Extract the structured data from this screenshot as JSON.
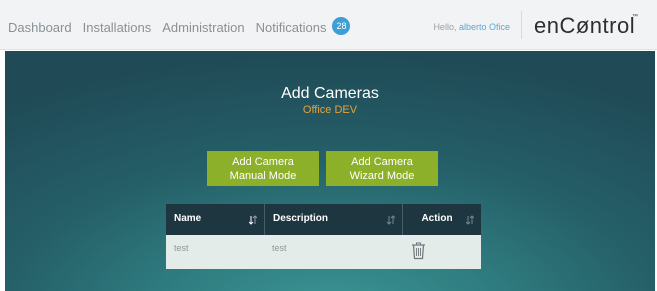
{
  "nav": {
    "items": [
      "Dashboard",
      "Installations",
      "Administration",
      "Notifications"
    ],
    "notification_count": "28"
  },
  "user": {
    "greeting": "Hello,",
    "name": "alberto Ofice"
  },
  "brand": {
    "logo": "enCøntrol",
    "tm": "™"
  },
  "page": {
    "title": "Add Cameras",
    "subtitle": "Office DEV"
  },
  "buttons": {
    "manual": {
      "line1": "Add Camera",
      "line2": "Manual Mode"
    },
    "wizard": {
      "line1": "Add Camera",
      "line2": "Wizard Mode"
    }
  },
  "table": {
    "columns": [
      "Name",
      "Description",
      "Action"
    ],
    "rows": [
      {
        "name": "test",
        "description": "test",
        "action_icon": "trash-icon"
      }
    ]
  },
  "colors": {
    "accent_button": "#8db02b",
    "subtitle": "#e8a23a",
    "badge": "#3d9fd6",
    "table_header": "#1e3640"
  }
}
